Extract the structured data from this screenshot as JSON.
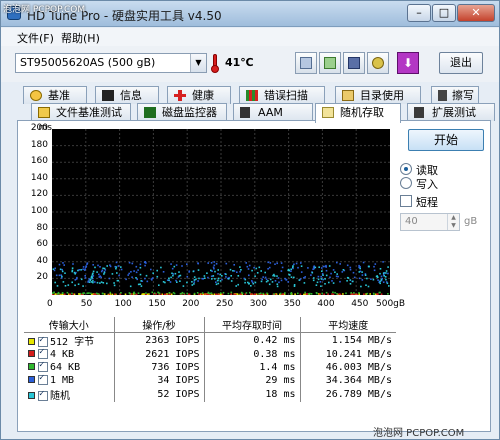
{
  "window": {
    "title": "HD Tune Pro - 硬盘实用工具 v4.50",
    "watermark_top": "泡泡网 PCPOP.COM",
    "watermark_bottom": "泡泡网 PCPOP.COM"
  },
  "menu": {
    "file": "文件(F)",
    "help": "帮助(H)"
  },
  "toolbar": {
    "drive": "ST95005620AS (500 gB)",
    "temperature": "41℃",
    "exit": "退出"
  },
  "tabs_row1": [
    "基准",
    "信息",
    "健康",
    "错误扫描",
    "目录使用",
    "擦写"
  ],
  "tabs_row2": [
    "文件基准测试",
    "磁盘监控器",
    "AAM",
    "随机存取",
    "扩展测试"
  ],
  "chart_data": {
    "type": "scatter",
    "ylabel": "ms",
    "ylim": [
      0,
      200
    ],
    "yticks": [
      200,
      180,
      160,
      140,
      120,
      100,
      80,
      60,
      40,
      20
    ],
    "xlim": [
      0,
      500
    ],
    "xticks": [
      "0",
      "50",
      "100",
      "150",
      "200",
      "250",
      "300",
      "350",
      "400",
      "450",
      "500gB"
    ],
    "grid": true,
    "series": [
      {
        "name": "512 字节",
        "color": "#e6e600",
        "y_range": [
          0.3,
          1.0
        ]
      },
      {
        "name": "4 KB",
        "color": "#d41c1c",
        "y_range": [
          0.3,
          1.0
        ]
      },
      {
        "name": "64 KB",
        "color": "#2eb82e",
        "y_range": [
          1.0,
          3.0
        ]
      },
      {
        "name": "1 MB",
        "color": "#2b5fd9",
        "y_range": [
          15,
          40
        ]
      },
      {
        "name": "随机",
        "color": "#29c6d6",
        "y_range": [
          10,
          35
        ]
      }
    ]
  },
  "controls": {
    "start": "开始",
    "read": "读取",
    "write": "写入",
    "short": "短程",
    "short_value": "40",
    "short_unit": "gB"
  },
  "table": {
    "headers": [
      "传输大小",
      "操作/秒",
      "平均存取时间",
      "平均速度"
    ],
    "rows": [
      {
        "size": "512 字节",
        "color": "#e6e600",
        "ops": "2363",
        "ops_unit": "IOPS",
        "time": "0.42",
        "time_unit": "ms",
        "speed": "1.154",
        "speed_unit": "MB/s"
      },
      {
        "size": "4 KB",
        "color": "#d41c1c",
        "ops": "2621",
        "ops_unit": "IOPS",
        "time": "0.38",
        "time_unit": "ms",
        "speed": "10.241",
        "speed_unit": "MB/s"
      },
      {
        "size": "64 KB",
        "color": "#2eb82e",
        "ops": "736",
        "ops_unit": "IOPS",
        "time": "1.4",
        "time_unit": "ms",
        "speed": "46.003",
        "speed_unit": "MB/s"
      },
      {
        "size": "1 MB",
        "color": "#2b5fd9",
        "ops": "34",
        "ops_unit": "IOPS",
        "time": "29",
        "time_unit": "ms",
        "speed": "34.364",
        "speed_unit": "MB/s"
      },
      {
        "size": "随机",
        "color": "#29c6d6",
        "ops": "52",
        "ops_unit": "IOPS",
        "time": "18",
        "time_unit": "ms",
        "speed": "26.789",
        "speed_unit": "MB/s"
      }
    ]
  }
}
